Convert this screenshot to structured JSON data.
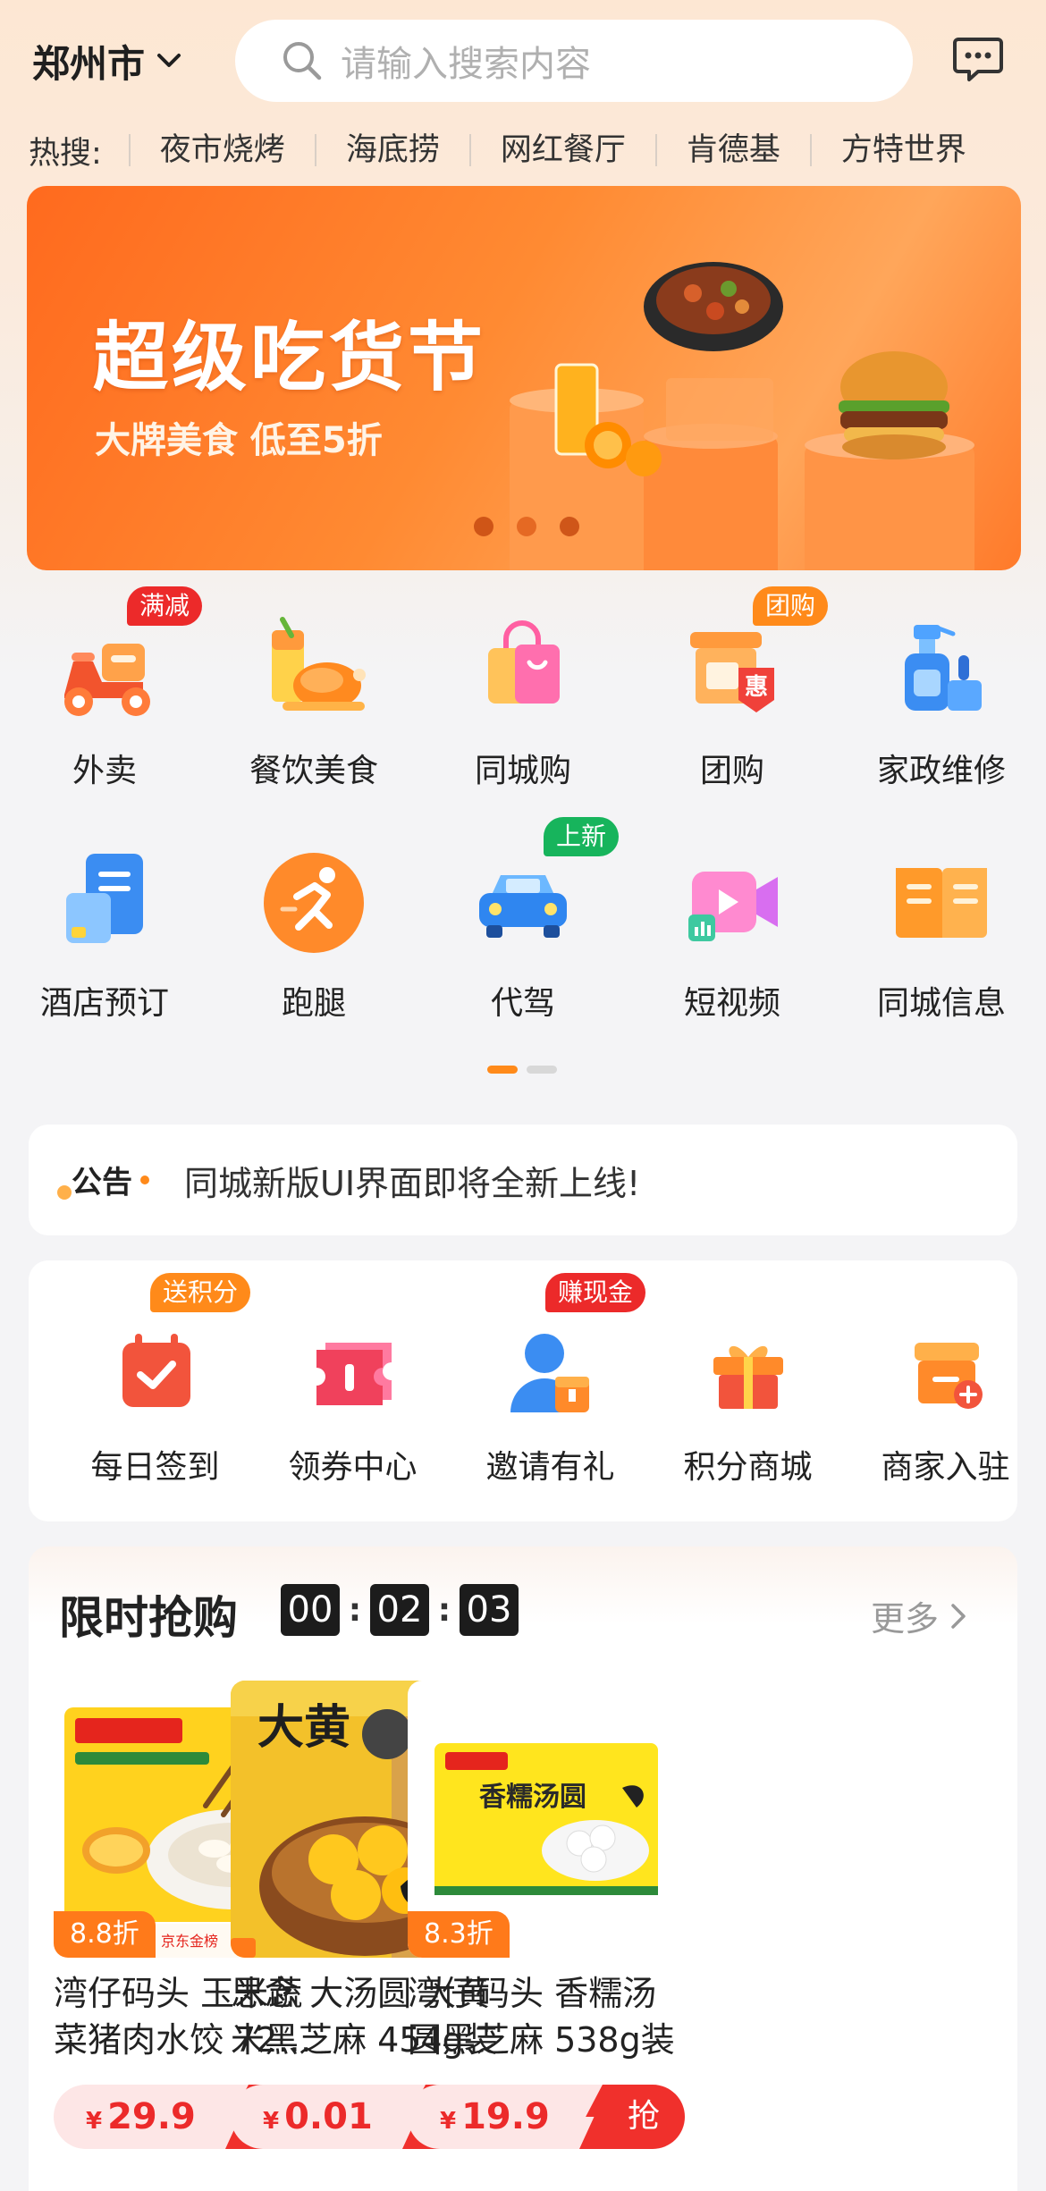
{
  "header": {
    "city": "郑州市",
    "search_placeholder": "请输入搜索内容"
  },
  "hot_search": {
    "label": "热搜:",
    "keywords": [
      "夜市烧烤",
      "海底捞",
      "网红餐厅",
      "肯德基",
      "方特世界"
    ]
  },
  "banner": {
    "title": "超级吃货节",
    "subtitle": "大牌美食 低至5折",
    "slide_count": 3,
    "active_slide": 2
  },
  "services": [
    {
      "label": "外卖",
      "badge": "满减",
      "icon": "scooter-icon"
    },
    {
      "label": "餐饮美食",
      "badge": "",
      "icon": "roast-chicken-icon"
    },
    {
      "label": "同城购",
      "badge": "",
      "icon": "shopping-bag-icon"
    },
    {
      "label": "团购",
      "badge": "团购",
      "icon": "group-buy-store-icon"
    },
    {
      "label": "家政维修",
      "badge": "",
      "icon": "cleaning-spray-icon"
    },
    {
      "label": "酒店预订",
      "badge": "",
      "icon": "hotel-document-icon"
    },
    {
      "label": "跑腿",
      "badge": "",
      "icon": "runner-icon"
    },
    {
      "label": "代驾",
      "badge": "上新",
      "icon": "car-icon"
    },
    {
      "label": "短视频",
      "badge": "",
      "icon": "video-camera-icon"
    },
    {
      "label": "同城信息",
      "badge": "",
      "icon": "open-book-icon"
    }
  ],
  "notice": {
    "logo_text": "公告",
    "text": "同城新版UI界面即将全新上线!"
  },
  "tasks": [
    {
      "label": "每日签到",
      "badge": "送积分",
      "icon": "calendar-check-icon"
    },
    {
      "label": "领券中心",
      "badge": "",
      "icon": "ticket-icon"
    },
    {
      "label": "邀请有礼",
      "badge": "赚现金",
      "icon": "user-gift-icon"
    },
    {
      "label": "积分商城",
      "badge": "",
      "icon": "gift-box-icon"
    },
    {
      "label": "商家入驻",
      "badge": "",
      "icon": "store-add-icon"
    }
  ],
  "flash_sale": {
    "title": "限时抢购",
    "timer": {
      "h": "00",
      "m": "02",
      "s": "03"
    },
    "more_label": "更多",
    "products": [
      {
        "name": "湾仔码头 玉米蔬菜猪肉水饺 720克",
        "discount": "8.8折",
        "price": "29.9",
        "currency": "¥",
        "grab_label": "抢",
        "image_icon": "dumpling-package-icon"
      },
      {
        "name": "思念 大汤圆 大黄米黑芝麻 454g装",
        "discount": "",
        "price": "0.01",
        "currency": "¥",
        "grab_label": "抢",
        "image_icon": "tangyuan-bowl-icon"
      },
      {
        "name": "湾仔码头 香糯汤圆黑芝麻 538g装",
        "discount": "8.3折",
        "price": "19.9",
        "currency": "¥",
        "grab_label": "抢",
        "image_icon": "tangyuan-package-icon"
      }
    ]
  },
  "colors": {
    "brand_orange": "#ff7a1a",
    "badge_red": "#ec2a2a",
    "badge_orange": "#ff8a1a",
    "badge_green": "#17b45c",
    "price_red": "#ec2a2a"
  }
}
